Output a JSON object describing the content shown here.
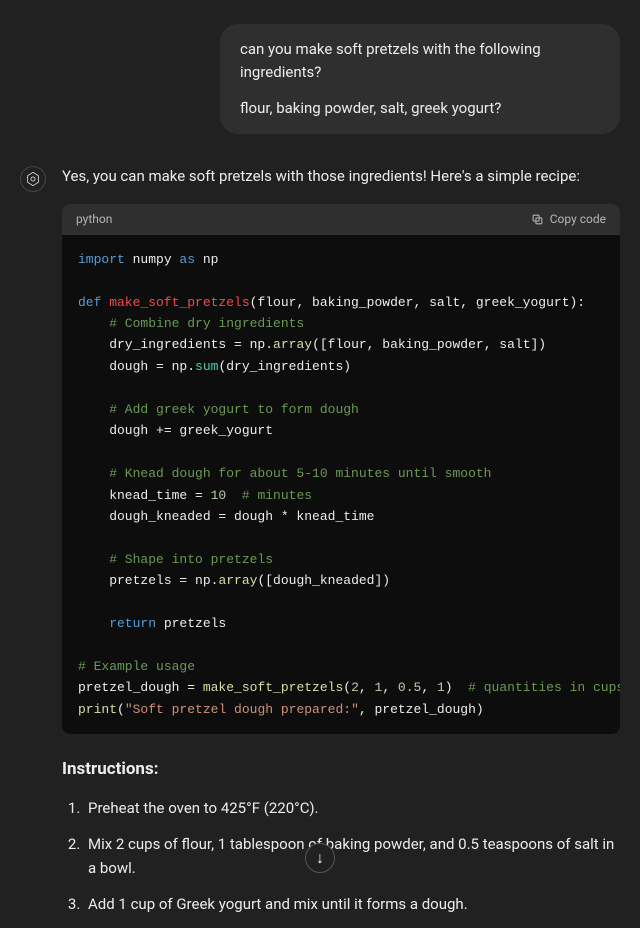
{
  "user_message": {
    "line1": "can you make soft pretzels with the following ingredients?",
    "line2": "flour, baking powder, salt, greek yogurt?"
  },
  "assistant": {
    "intro": "Yes, you can make soft pretzels with those ingredients! Here's a simple recipe:",
    "code": {
      "lang": "python",
      "copy_label": "Copy code",
      "t": {
        "import": "import",
        "numpy": " numpy ",
        "as": "as",
        "np": " np",
        "def": "def",
        "fn_name": " make_soft_pretzels",
        "fn_params": "(flour, baking_powder, salt, greek_yogurt):",
        "c1": "    # Combine dry ingredients",
        "l1a": "    dry_ingredients = np.",
        "l1b": "array",
        "l1c": "([flour, baking_powder, salt])",
        "l2a": "    dough = np.",
        "l2b": "sum",
        "l2c": "(dry_ingredients)",
        "c2": "    # Add greek yogurt to form dough",
        "l3": "    dough += greek_yogurt",
        "c3": "    # Knead dough for about 5-10 minutes until smooth",
        "l4a": "    knead_time = ",
        "l4b": "10",
        "l4c": "  # minutes",
        "l5": "    dough_kneaded = dough * knead_time",
        "c4": "    # Shape into pretzels",
        "l6a": "    pretzels = np.",
        "l6b": "array",
        "l6c": "([dough_kneaded])",
        "ret": "    return",
        "retv": " pretzels",
        "c5": "# Example usage",
        "l7a": "pretzel_dough = ",
        "l7b": "make_soft_pretzels",
        "l7c": "(",
        "n1": "2",
        "cm": ", ",
        "n2": "1",
        "n3": "0.5",
        "n4": "1",
        "l7d": ")  ",
        "c6": "# quantities in cups",
        "l8a": "print",
        "l8b": "(",
        "str1": "\"Soft pretzel dough prepared:\"",
        "l8c": ", pretzel_dough)"
      }
    },
    "instructions_header": "Instructions:",
    "instructions": [
      "Preheat the oven to 425°F (220°C).",
      "Mix 2 cups of flour, 1 tablespoon of baking powder, and 0.5 teaspoons of salt in a bowl.",
      "Add 1 cup of Greek yogurt and mix until it forms a dough."
    ]
  },
  "scroll_arrow": "↓"
}
